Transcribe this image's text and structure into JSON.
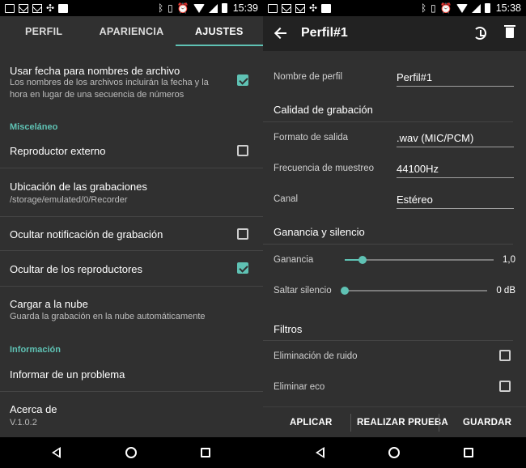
{
  "status_left": {
    "time": "15:39"
  },
  "status_right": {
    "time": "15:38"
  },
  "left": {
    "tabs": [
      {
        "label": "PERFIL"
      },
      {
        "label": "APARIENCIA"
      },
      {
        "label": "AJUSTES"
      }
    ],
    "active_tab": 2,
    "items": {
      "fecha": {
        "title": "Usar fecha para nombres de archivo",
        "subtitle": "Los nombres de los archivos incluirán la fecha y la hora en lugar de una secuencia de números",
        "checked": true
      },
      "section_misc": "Misceláneo",
      "reproductor": {
        "title": "Reproductor externo",
        "checked": false
      },
      "ubicacion": {
        "title": "Ubicación de las grabaciones",
        "subtitle": "/storage/emulated/0/Recorder"
      },
      "ocultar_notif": {
        "title": "Ocultar notificación de grabación",
        "checked": false
      },
      "ocultar_repro": {
        "title": "Ocultar de los reproductores",
        "checked": true
      },
      "nube": {
        "title": "Cargar a la nube",
        "subtitle": "Guarda la grabación en la nube automáticamente"
      },
      "section_info": "Información",
      "problema": {
        "title": "Informar de un problema"
      },
      "acerca": {
        "title": "Acerca de",
        "subtitle": "V.1.0.2"
      }
    }
  },
  "right": {
    "title": "Perfil#1",
    "nombre_label": "Nombre de perfil",
    "nombre_value": "Perfil#1",
    "calidad_section": "Calidad de grabación",
    "formato_label": "Formato de salida",
    "formato_value": ".wav (MIC/PCM)",
    "frecuencia_label": "Frecuencia de muestreo",
    "frecuencia_value": "44100Hz",
    "canal_label": "Canal",
    "canal_value": "Estéreo",
    "ganancia_section": "Ganancia y silencio",
    "ganancia_label": "Ganancia",
    "ganancia_value": "1,0",
    "ganancia_fraction": 0.12,
    "saltar_label": "Saltar silencio",
    "saltar_value": "0 dB",
    "saltar_fraction": 0.0,
    "filtros_section": "Filtros",
    "ruido_label": "Eliminación de ruido",
    "ruido_checked": false,
    "eco_label": "Eliminar eco",
    "eco_checked": false,
    "buttons": {
      "aplicar": "APLICAR",
      "prueba": "REALIZAR PRUEBA",
      "guardar": "GUARDAR"
    }
  },
  "colors": {
    "accent": "#5fc2b4",
    "background": "#303030",
    "appbar": "#222222"
  }
}
